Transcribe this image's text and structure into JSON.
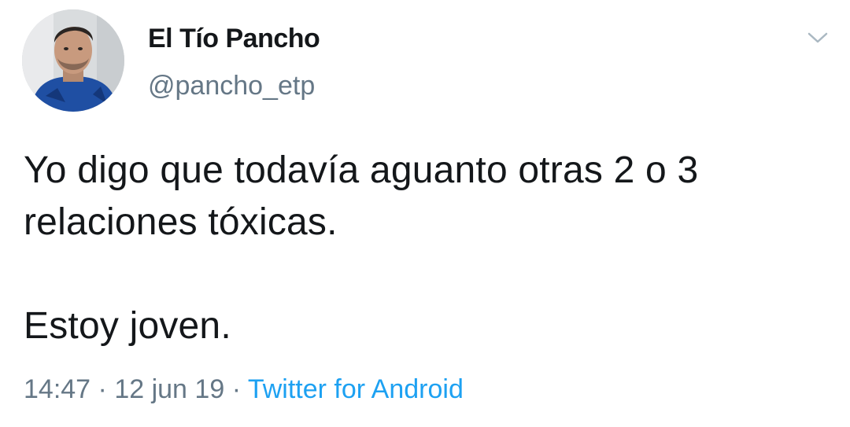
{
  "tweet": {
    "author": {
      "display_name": "El Tío Pancho",
      "handle": "@pancho_etp"
    },
    "text": "Yo digo que todavía aguanto otras 2 o 3\nrelaciones tóxicas.\n\nEstoy joven.",
    "time": "14:47",
    "separator": "·",
    "date": "12 jun 19",
    "source": "Twitter for Android",
    "menu_icon": "chevron-down-icon"
  },
  "colors": {
    "text": "#14171a",
    "secondary": "#657786",
    "link": "#1da1f2",
    "background": "#ffffff"
  }
}
